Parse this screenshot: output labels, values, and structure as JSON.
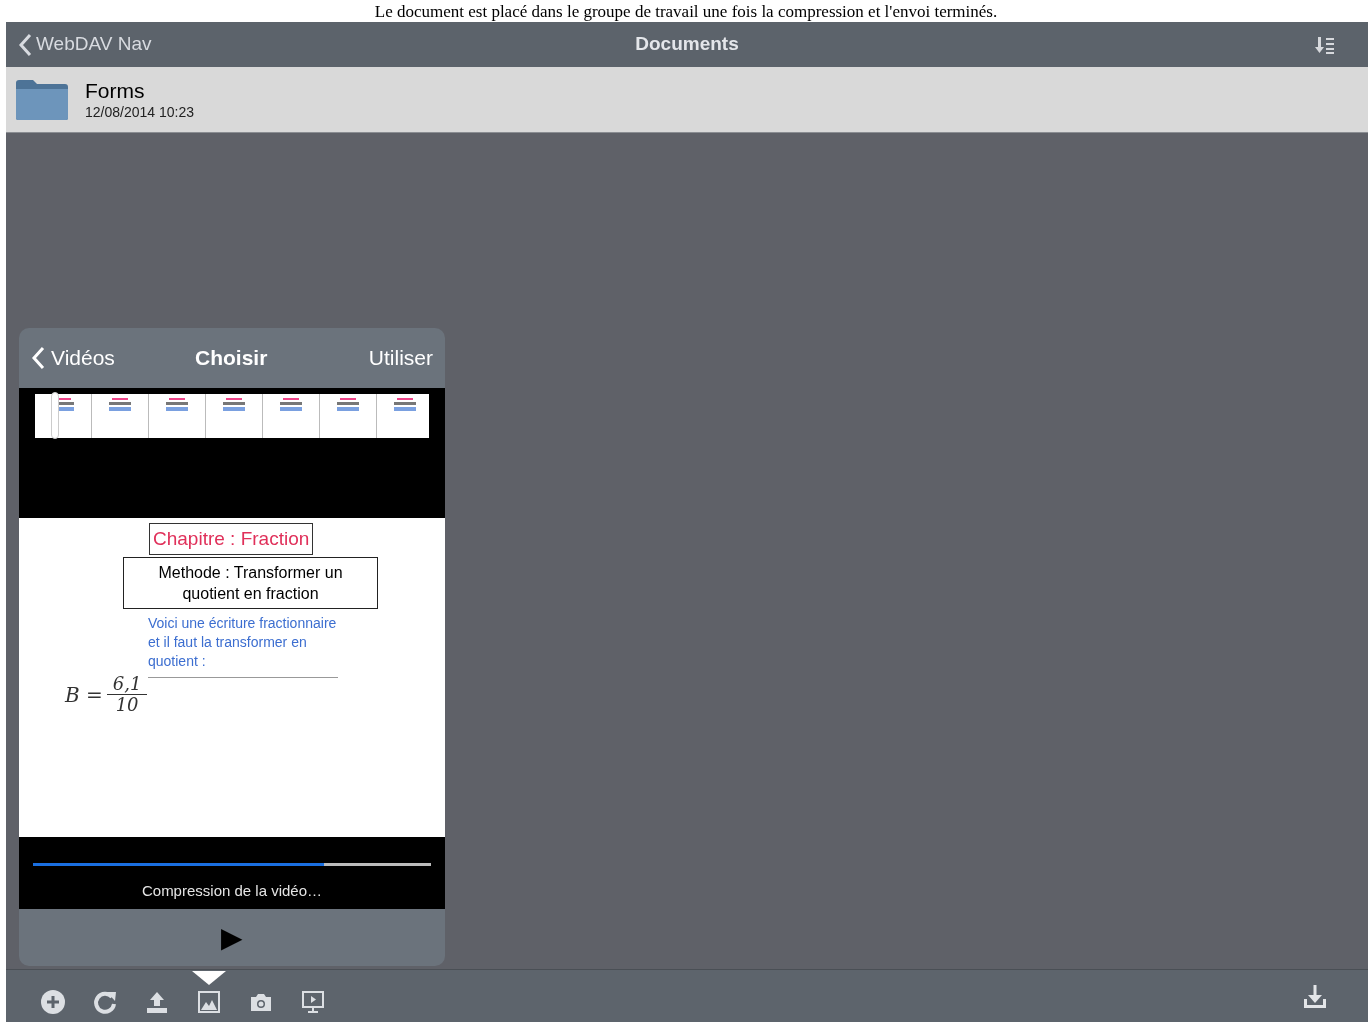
{
  "caption": "Le document est placé dans le groupe de travail une fois la compression et l'envoi terminés.",
  "nav_bar": {
    "back": "WebDAV Nav",
    "title": "Documents"
  },
  "files": [
    {
      "name": "Forms",
      "date": "12/08/2014 10:23",
      "selected": true
    }
  ],
  "popover": {
    "back": "Vidéos",
    "title": "Choisir",
    "action": "Utiliser",
    "slide": {
      "title": "Chapitre : Fraction",
      "method": "Methode : Transformer un quotient en fraction",
      "text": "Voici une écriture fractionnaire et il faut la transformer en quotient :",
      "formula_lhs": "B =",
      "numerator": "6,1",
      "denominator": "10"
    },
    "progress": {
      "level": 0.73,
      "label": "Compression de la vidéo…"
    },
    "play": "▶"
  },
  "toolbar": [
    {
      "kind": "add",
      "selected": false
    },
    {
      "kind": "refresh",
      "selected": false
    },
    {
      "kind": "upload",
      "selected": false
    },
    {
      "kind": "photos",
      "selected": true
    },
    {
      "kind": "camera",
      "selected": false
    },
    {
      "kind": "slideshow",
      "selected": false
    }
  ]
}
